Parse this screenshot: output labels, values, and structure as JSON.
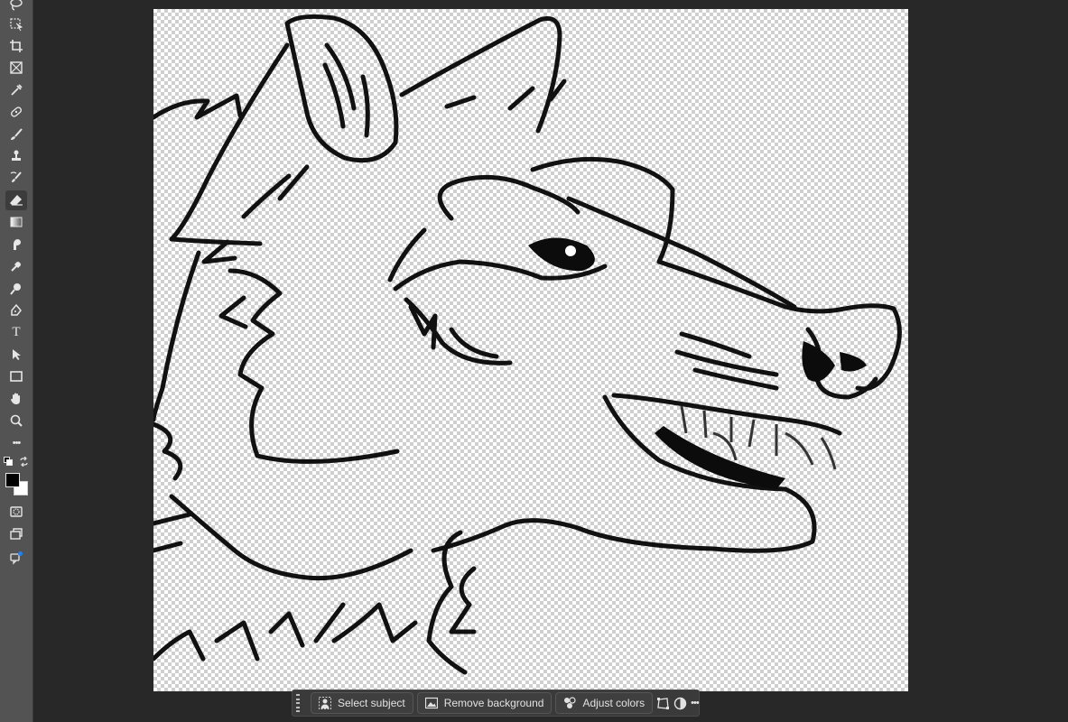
{
  "toolbar": {
    "tools": [
      {
        "icon": "lasso-icon"
      },
      {
        "icon": "object-selection-icon"
      },
      {
        "icon": "crop-icon"
      },
      {
        "icon": "frame-icon"
      },
      {
        "icon": "eyedropper-icon"
      },
      {
        "icon": "spot-healing-icon"
      },
      {
        "icon": "brush-icon"
      },
      {
        "icon": "clone-stamp-icon"
      },
      {
        "icon": "history-brush-icon"
      },
      {
        "icon": "eraser-icon",
        "active": true
      },
      {
        "icon": "gradient-icon"
      },
      {
        "icon": "smudge-icon"
      },
      {
        "icon": "dodge-icon"
      },
      {
        "icon": "burn-icon"
      },
      {
        "icon": "pen-icon"
      },
      {
        "icon": "type-icon",
        "glyph": "T"
      },
      {
        "icon": "path-selection-icon"
      },
      {
        "icon": "rectangle-icon"
      },
      {
        "icon": "hand-icon"
      },
      {
        "icon": "zoom-icon"
      },
      {
        "icon": "more-tools-icon",
        "glyph": "•••"
      }
    ],
    "foreground_color": "#000000",
    "background_color": "#ffffff"
  },
  "contextual_taskbar": {
    "select_subject_label": "Select subject",
    "remove_background_label": "Remove background",
    "adjust_colors_label": "Adjust colors",
    "more_glyph": "•••"
  },
  "colors": {
    "toolbar_bg": "#535353",
    "workspace_bg": "#282828",
    "taskbar_bg": "#3a3a3a",
    "accent": "#2680eb"
  }
}
